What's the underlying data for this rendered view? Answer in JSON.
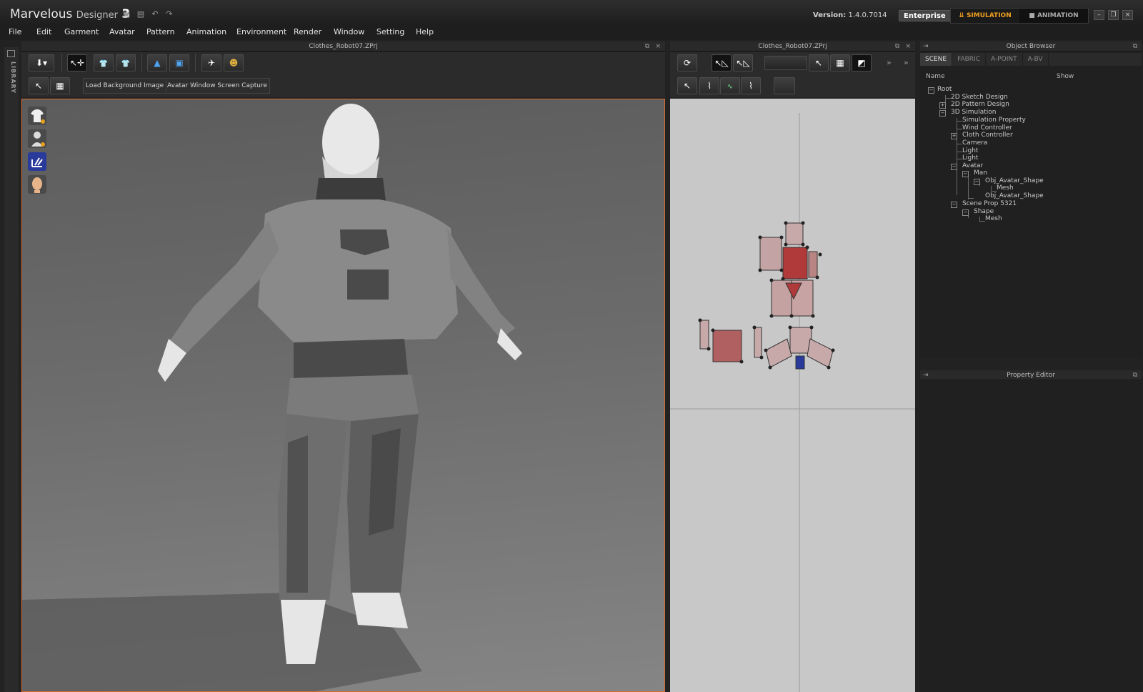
{
  "app": {
    "name": "Marvelous",
    "sub": "Designer",
    "num": "3"
  },
  "version": {
    "label": "Version:",
    "value": "1.4.0.7014"
  },
  "edition": "Enterprise",
  "modes": {
    "simulation": "SIMULATION",
    "animation": "ANIMATION"
  },
  "menu": [
    "File",
    "Edit",
    "Garment",
    "Avatar",
    "Pattern",
    "Animation",
    "Environment",
    "Render",
    "Window",
    "Setting",
    "Help"
  ],
  "library_label": "LIBRARY",
  "panel3d": {
    "title": "Clothes_Robot07.ZPrj",
    "subbar_buttons": [
      "Load Background Image",
      "Avatar Window Screen Capture"
    ]
  },
  "panel2d": {
    "title": "Clothes_Robot07.ZPrj"
  },
  "object_browser": {
    "title": "Object Browser",
    "tabs": [
      "SCENE",
      "FABRIC",
      "A-POINT",
      "A-BV"
    ],
    "columns": {
      "name": "Name",
      "show": "Show"
    },
    "tree": [
      {
        "label": "Root"
      },
      {
        "label": "2D Sketch Design"
      },
      {
        "label": "2D Pattern Design"
      },
      {
        "label": "3D Simulation"
      },
      {
        "label": "Simulation Property"
      },
      {
        "label": "Wind Controller"
      },
      {
        "label": "Cloth Controller"
      },
      {
        "label": "Camera"
      },
      {
        "label": "Light"
      },
      {
        "label": "Light"
      },
      {
        "label": "Avatar"
      },
      {
        "label": "Man"
      },
      {
        "label": "Obj_Avatar_Shape"
      },
      {
        "label": "Mesh"
      },
      {
        "label": "Obj_Avatar_Shape"
      },
      {
        "label": "Scene Prop 5321"
      },
      {
        "label": "Shape"
      },
      {
        "label": "Mesh"
      }
    ]
  },
  "property_editor": {
    "title": "Property Editor"
  },
  "colors": {
    "accent": "#d86a2c",
    "mode_active": "#f0a020"
  }
}
